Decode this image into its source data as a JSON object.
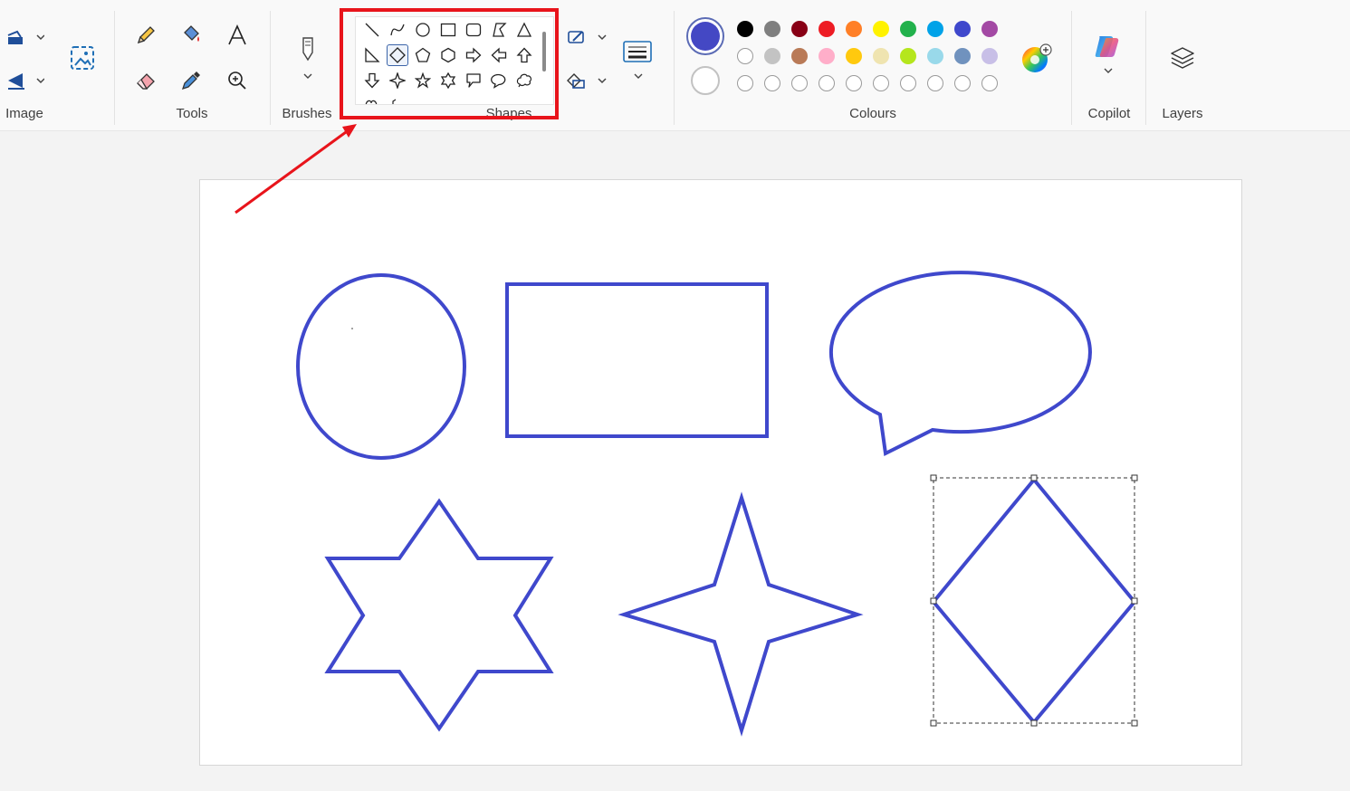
{
  "ribbon": {
    "groups": {
      "image": "Image",
      "tools": "Tools",
      "brushes": "Brushes",
      "shapes": "Shapes",
      "colours": "Colours",
      "copilot": "Copilot",
      "layers": "Layers"
    },
    "shapes_selected": "diamond",
    "shape_icons": [
      "line",
      "curve",
      "oval",
      "rectangle",
      "rounded-rectangle",
      "polygon",
      "triangle",
      "right-triangle",
      "diamond",
      "pentagon",
      "hexagon",
      "right-arrow",
      "left-arrow",
      "up-arrow",
      "down-arrow",
      "four-point-star",
      "five-point-star",
      "six-point-star",
      "rectangular-callout",
      "oval-callout",
      "cloud-callout"
    ]
  },
  "colours": {
    "primary": "#4448c4",
    "secondary": "#ffffff",
    "palette_row1": [
      "#000000",
      "#7f7f7f",
      "#880015",
      "#ed1c24",
      "#ff7f27",
      "#fff200",
      "#22b14c",
      "#00a2e8",
      "#3f48cc",
      "#a349a4"
    ],
    "palette_row2": [
      "#ffffff",
      "#c3c3c3",
      "#b97a57",
      "#ffaec9",
      "#ffc90e",
      "#efe4b0",
      "#b5e61d",
      "#99d9ea",
      "#7092be",
      "#c8bfe7"
    ],
    "palette_row3_empty": 10,
    "stroke": "#3f48cc",
    "highlight": "#e8141b"
  },
  "canvas": {
    "drawn_shapes": [
      "oval",
      "rectangle",
      "oval-callout",
      "six-point-star",
      "four-point-star",
      "diamond"
    ],
    "selected_shape": "diamond"
  }
}
